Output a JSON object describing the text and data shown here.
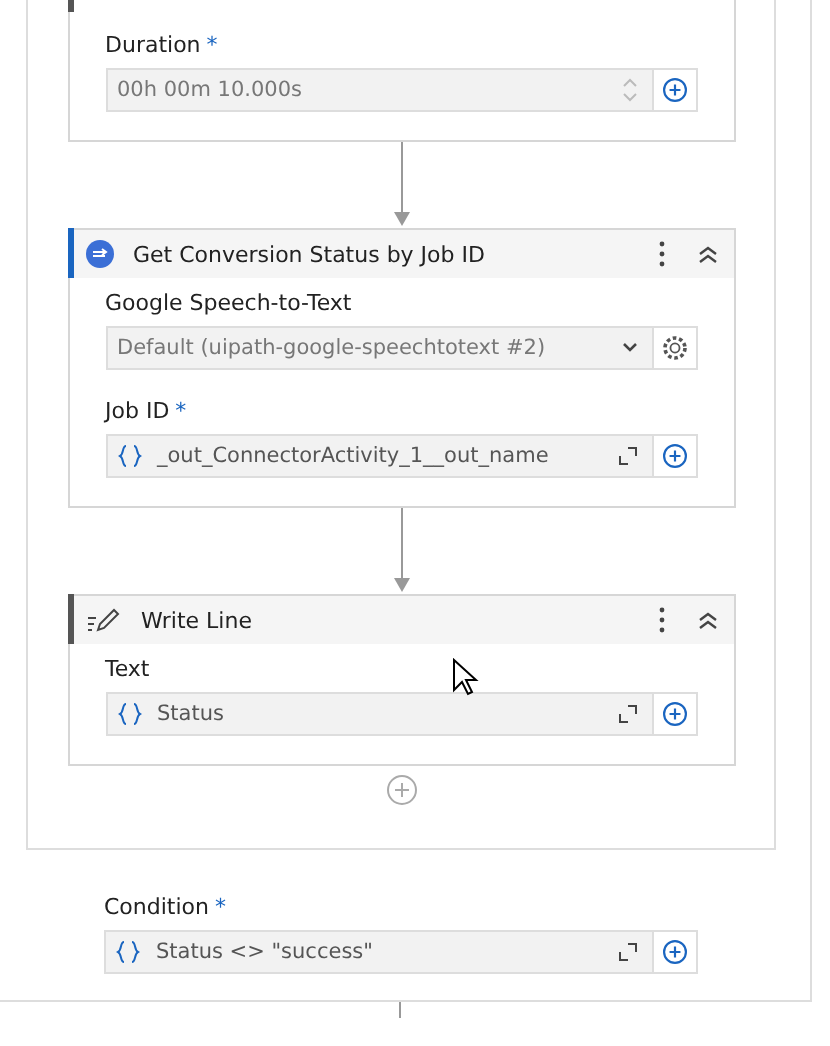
{
  "cards": [
    {
      "selected": false,
      "hovered": true,
      "fields": [
        {
          "label": "Duration",
          "required_mark": "*",
          "kind": "duration",
          "value": "00h 00m 10.000s"
        }
      ]
    },
    {
      "kind": "connector",
      "title": "Get Conversion Status by Job ID",
      "selected": true,
      "hovered": false,
      "fields": [
        {
          "label": "Google Speech-to-Text",
          "kind": "dropdown",
          "value": "Default (uipath-google-speechtotext #2)"
        },
        {
          "label": "Job ID",
          "required_mark": "*",
          "kind": "expression",
          "value": "_out_ConnectorActivity_1__out_name"
        }
      ]
    },
    {
      "kind": "write",
      "title": "Write Line",
      "selected": false,
      "hovered": true,
      "fields": [
        {
          "label": "Text",
          "kind": "expression",
          "value": "Status"
        }
      ]
    }
  ],
  "condition": {
    "label": "Condition",
    "required_mark": "*",
    "kind": "expression",
    "value": "Status <> \"success\""
  }
}
